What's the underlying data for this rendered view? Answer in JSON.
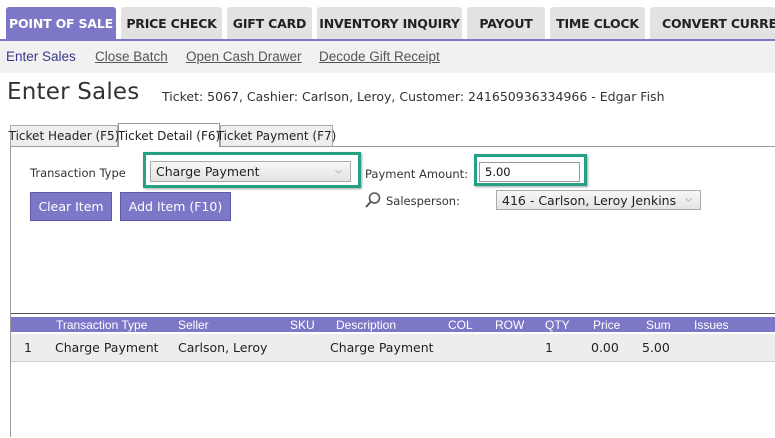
{
  "topnav": {
    "tabs": [
      {
        "label": "POINT OF SALE",
        "active": true
      },
      {
        "label": "PRICE CHECK"
      },
      {
        "label": "GIFT CARD"
      },
      {
        "label": "INVENTORY INQUIRY"
      },
      {
        "label": "PAYOUT"
      },
      {
        "label": "TIME CLOCK"
      },
      {
        "label": "CONVERT CURRENCY"
      }
    ]
  },
  "subnav": {
    "links": [
      "Enter Sales",
      "Close Batch",
      "Open Cash Drawer",
      "Decode Gift Receipt"
    ]
  },
  "header": {
    "title": "Enter Sales",
    "ticket_info": "Ticket: 5067, Cashier: Carlson, Leroy, Customer: 241650936334966 - Edgar Fish"
  },
  "section_tabs": [
    "Ticket Header (F5)",
    "Ticket Detail (F6)",
    "Ticket Payment (F7)"
  ],
  "form": {
    "transaction_type_label": "Transaction Type",
    "transaction_type_value": "Charge Payment",
    "payment_amount_label": "Payment Amount:",
    "payment_amount_value": "5.00",
    "salesperson_label": "Salesperson:",
    "salesperson_value": "416 - Carlson, Leroy  Jenkins",
    "clear_item_label": "Clear Item",
    "add_item_label": "Add Item (F10)"
  },
  "grid": {
    "columns": [
      "Transaction Type",
      "Seller",
      "SKU",
      "Description",
      "COL",
      "ROW",
      "QTY",
      "Price",
      "Sum",
      "Issues"
    ],
    "rows": [
      {
        "num": "1",
        "transaction_type": "Charge Payment",
        "seller": "Carlson, Leroy",
        "sku": "",
        "description": "Charge Payment",
        "col": "",
        "row": "",
        "qty": "1",
        "price": "0.00",
        "sum": "5.00",
        "issues": ""
      }
    ]
  },
  "colors": {
    "accent": "#7c77c6",
    "highlight": "#27a185"
  }
}
